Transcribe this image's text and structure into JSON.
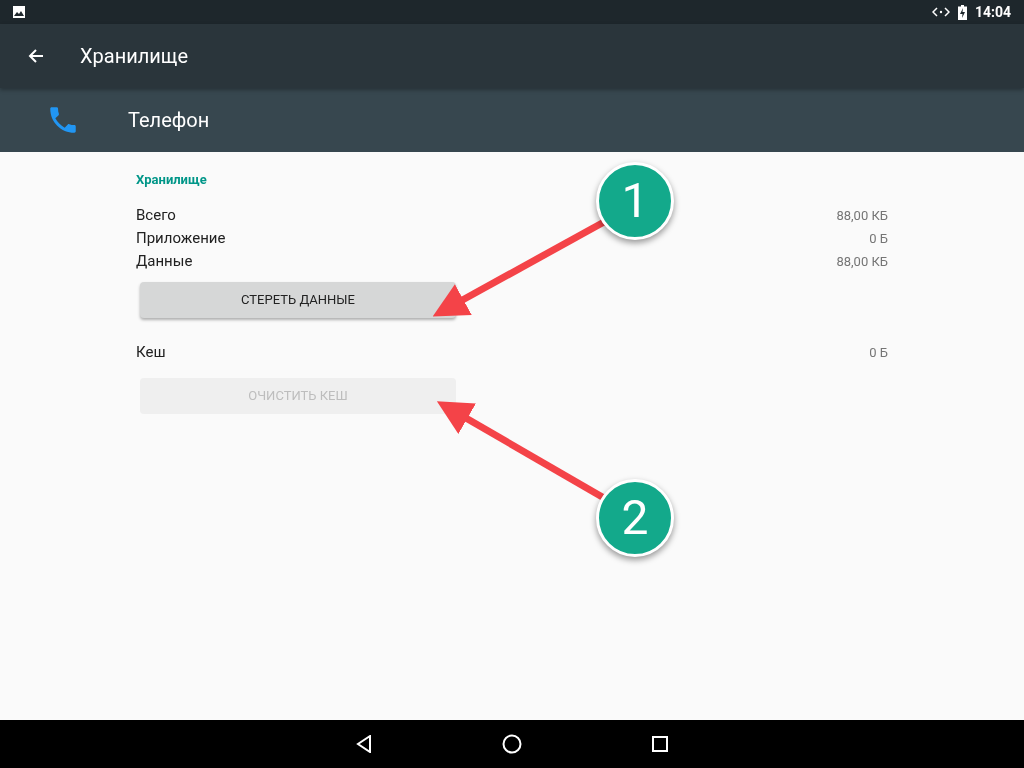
{
  "status_bar": {
    "time": "14:04"
  },
  "toolbar": {
    "title": "Хранилище"
  },
  "app": {
    "name": "Телефон"
  },
  "section": {
    "title": "Хранилище",
    "rows": [
      {
        "label": "Всего",
        "value": "88,00 КБ"
      },
      {
        "label": "Приложение",
        "value": "0 Б"
      },
      {
        "label": "Данные",
        "value": "88,00 КБ"
      }
    ],
    "clear_data_button": {
      "label": "СТЕРЕТЬ ДАННЫЕ",
      "disabled": false
    },
    "cache_row": {
      "label": "Кеш",
      "value": "0 Б"
    },
    "clear_cache_button": {
      "label": "ОЧИСТИТЬ КЕШ",
      "disabled": true
    }
  },
  "annotations": [
    {
      "number": "1"
    },
    {
      "number": "2"
    }
  ]
}
